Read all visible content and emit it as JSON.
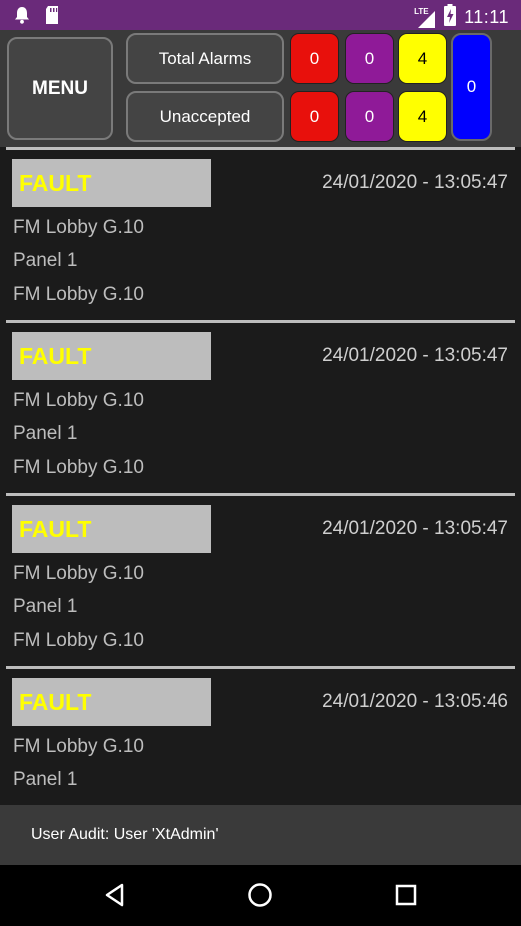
{
  "status_bar": {
    "time": "11:11",
    "network": "LTE",
    "icons": [
      "notification-bell-icon",
      "sd-card-icon",
      "signal-icon",
      "battery-charging-icon"
    ]
  },
  "header": {
    "menu_label": "MENU",
    "total_label": "Total Alarms",
    "unaccepted_label": "Unaccepted",
    "total_counts": [
      "0",
      "0",
      "4"
    ],
    "unaccepted_counts": [
      "0",
      "0",
      "4"
    ],
    "blue_count": "0"
  },
  "colors": {
    "red": "#e8100c",
    "purple": "#8f1a98",
    "yellow": "#ffff00",
    "blue": "#0000ff",
    "status_bar": "#6a2a7a"
  },
  "events": [
    {
      "type": "FAULT",
      "timestamp": "24/01/2020 - 13:05:47",
      "lines": [
        "FM Lobby G.10",
        "Panel 1",
        "FM Lobby G.10"
      ]
    },
    {
      "type": "FAULT",
      "timestamp": "24/01/2020 - 13:05:47",
      "lines": [
        "FM Lobby G.10",
        "Panel 1",
        "FM Lobby G.10"
      ]
    },
    {
      "type": "FAULT",
      "timestamp": "24/01/2020 - 13:05:47",
      "lines": [
        "FM Lobby G.10",
        "Panel 1",
        "FM Lobby G.10"
      ]
    },
    {
      "type": "FAULT",
      "timestamp": "24/01/2020 - 13:05:46",
      "lines": [
        "FM Lobby G.10",
        "Panel 1"
      ]
    }
  ],
  "footer": {
    "message": "User Audit: User 'XtAdmin'"
  },
  "nav": {
    "icons": [
      "back-icon",
      "home-icon",
      "recents-icon"
    ]
  }
}
